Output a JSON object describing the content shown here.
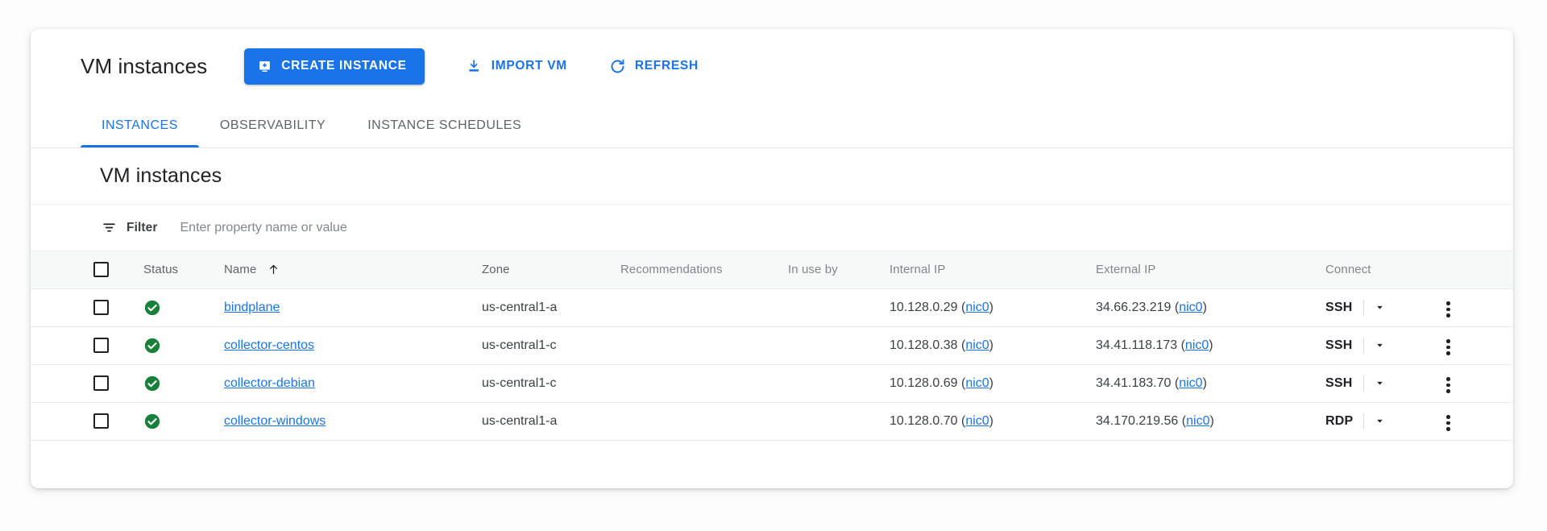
{
  "header": {
    "title": "VM instances",
    "create_button": "CREATE INSTANCE",
    "create_icon": "add-instance-icon",
    "import_button": "IMPORT VM",
    "import_icon": "download-icon",
    "refresh_button": "REFRESH",
    "refresh_icon": "refresh-icon",
    "accent_color": "#1a73e8"
  },
  "tabs": [
    {
      "label": "INSTANCES",
      "active": true
    },
    {
      "label": "OBSERVABILITY",
      "active": false
    },
    {
      "label": "INSTANCE SCHEDULES",
      "active": false
    }
  ],
  "section": {
    "title": "VM instances"
  },
  "filter": {
    "icon": "filter-icon",
    "label": "Filter",
    "placeholder": "Enter property name or value",
    "value": ""
  },
  "table": {
    "select_all_icon": "checkbox-unchecked-icon",
    "sort_icon": "sort-ascending-arrow-icon",
    "columns": [
      {
        "key": "status",
        "label": "Status",
        "dim": false
      },
      {
        "key": "name",
        "label": "Name",
        "dim": false,
        "sorted": "asc"
      },
      {
        "key": "zone",
        "label": "Zone",
        "dim": false
      },
      {
        "key": "recommendations",
        "label": "Recommendations",
        "dim": true
      },
      {
        "key": "in_use_by",
        "label": "In use by",
        "dim": true
      },
      {
        "key": "internal_ip",
        "label": "Internal IP",
        "dim": true
      },
      {
        "key": "external_ip",
        "label": "External IP",
        "dim": true
      },
      {
        "key": "connect",
        "label": "Connect",
        "dim": true
      }
    ],
    "rows": [
      {
        "checked": false,
        "status": "running",
        "status_icon": "green-check-circle-icon",
        "name": "bindplane",
        "zone": "us-central1-a",
        "recommendations": "",
        "in_use_by": "",
        "internal_ip": "10.128.0.29",
        "internal_nic": "nic0",
        "external_ip": "34.66.23.219",
        "external_nic": "nic0",
        "connect": "SSH"
      },
      {
        "checked": false,
        "status": "running",
        "status_icon": "green-check-circle-icon",
        "name": "collector-centos",
        "zone": "us-central1-c",
        "recommendations": "",
        "in_use_by": "",
        "internal_ip": "10.128.0.38",
        "internal_nic": "nic0",
        "external_ip": "34.41.118.173",
        "external_nic": "nic0",
        "connect": "SSH"
      },
      {
        "checked": false,
        "status": "running",
        "status_icon": "green-check-circle-icon",
        "name": "collector-debian",
        "zone": "us-central1-c",
        "recommendations": "",
        "in_use_by": "",
        "internal_ip": "10.128.0.69",
        "internal_nic": "nic0",
        "external_ip": "34.41.183.70",
        "external_nic": "nic0",
        "connect": "SSH"
      },
      {
        "checked": false,
        "status": "running",
        "status_icon": "green-check-circle-icon",
        "name": "collector-windows",
        "zone": "us-central1-a",
        "recommendations": "",
        "in_use_by": "",
        "internal_ip": "10.128.0.70",
        "internal_nic": "nic0",
        "external_ip": "34.170.219.56",
        "external_nic": "nic0",
        "connect": "RDP"
      }
    ],
    "row_menu_icon": "more-vert-icon",
    "connect_caret_icon": "caret-down-icon",
    "status_color": "#188038"
  }
}
